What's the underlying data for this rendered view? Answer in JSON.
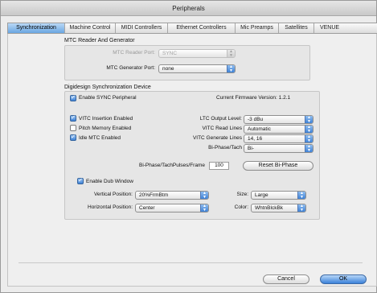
{
  "window": {
    "title": "Peripherals"
  },
  "tabs": [
    {
      "label": "Synchronization",
      "active": true
    },
    {
      "label": "Machine Control",
      "active": false
    },
    {
      "label": "MIDI Controllers",
      "active": false
    },
    {
      "label": "Ethernet Controllers",
      "active": false
    },
    {
      "label": "Mic Preamps",
      "active": false
    },
    {
      "label": "Satellites",
      "active": false
    },
    {
      "label": "VENUE",
      "active": false
    }
  ],
  "mtc": {
    "section_title": "MTC Reader And Generator",
    "reader_port_label": "MTC Reader Port:",
    "reader_port_value": "SYNC",
    "generator_port_label": "MTC Generator Port:",
    "generator_port_value": "none"
  },
  "sync_device": {
    "section_title": "Digidesign Synchronization Device",
    "enable_sync_label": "Enable SYNC Peripheral",
    "enable_sync_checked": true,
    "firmware_text": "Current Firmware Version: 1.2.1",
    "vitc_insertion_label": "VITC Insertion Enabled",
    "vitc_insertion_checked": true,
    "pitch_memory_label": "Pitch Memory Enabled",
    "pitch_memory_checked": false,
    "idle_mtc_label": "Idle MTC Enabled",
    "idle_mtc_checked": true,
    "ltc_output_label": "LTC Output Level:",
    "ltc_output_value": "-3 dBu",
    "vitc_read_label": "VITC Read Lines",
    "vitc_read_value": "Automatic",
    "vitc_generate_label": "VITC Generate Lines",
    "vitc_generate_value": "14, 16",
    "biphase_label": "Bi-Phase/Tach",
    "biphase_value": "Bi-",
    "pulses_label": "Bi-Phase/TachPulses/Frame",
    "pulses_value": "100",
    "reset_button": "Reset Bi-Phase"
  },
  "dub_window": {
    "enable_label": "Enable Dub Window",
    "enable_checked": true,
    "vertical_label": "Vertical Position:",
    "vertical_value": "20%FrmBtm",
    "horizontal_label": "Horizontal Position:",
    "horizontal_value": "Center",
    "size_label": "Size:",
    "size_value": "Large",
    "color_label": "Color:",
    "color_value": "WhtnBlckBk"
  },
  "footer": {
    "cancel_label": "Cancel",
    "ok_label": "OK"
  },
  "icons": {
    "popup_arrows": "updown-arrows-icon",
    "checkmark": "checkmark-icon"
  },
  "colors": {
    "accent": "#3f82d6",
    "tab_active": "#6aa7e2",
    "window_bg": "#ececec"
  }
}
